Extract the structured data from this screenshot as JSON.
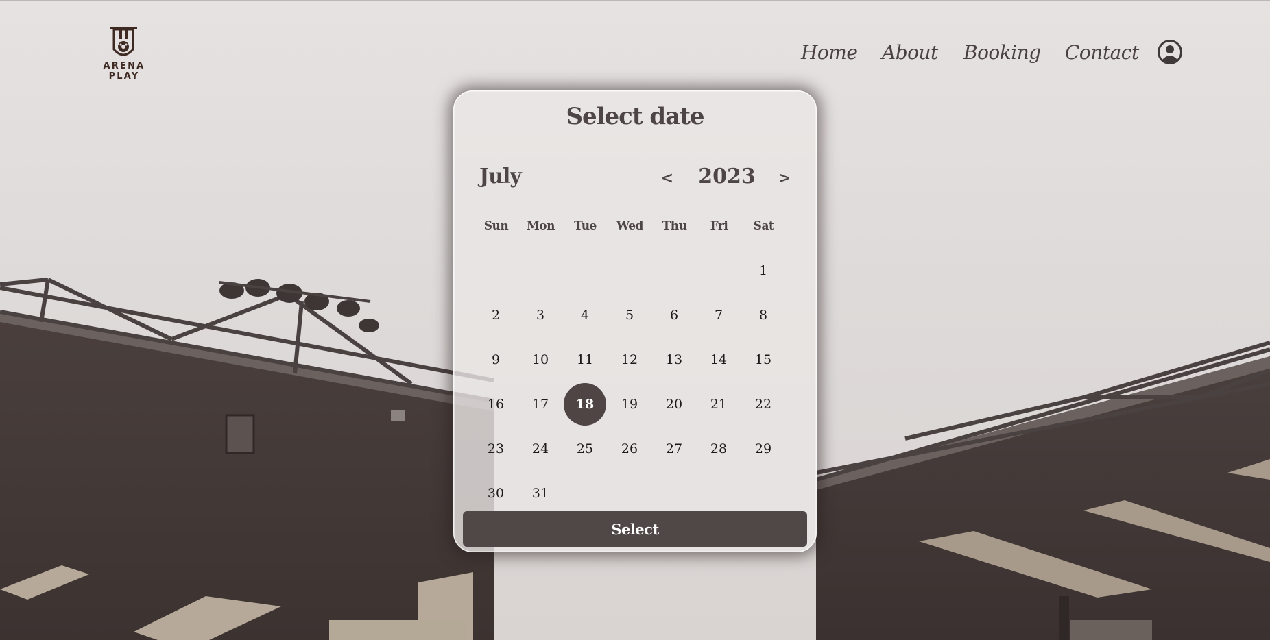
{
  "brand": {
    "logo_text": "ARENA PLAY"
  },
  "nav": {
    "items": [
      "Home",
      "About",
      "Booking",
      "Contact"
    ]
  },
  "datepicker": {
    "title": "Select date",
    "month": "July",
    "year": "2023",
    "prev_symbol": "<",
    "next_symbol": ">",
    "weekdays": [
      "Sun",
      "Mon",
      "Tue",
      "Wed",
      "Thu",
      "Fri",
      "Sat"
    ],
    "first_weekday_index": 6,
    "days_in_month": 31,
    "selected_day": 18,
    "select_label": "Select"
  },
  "colors": {
    "accent": "#4f4545",
    "text": "#4e4545",
    "logo": "#3e2a22"
  },
  "icons": {
    "user": "user-circle-icon",
    "logo": "football-crest-icon"
  }
}
